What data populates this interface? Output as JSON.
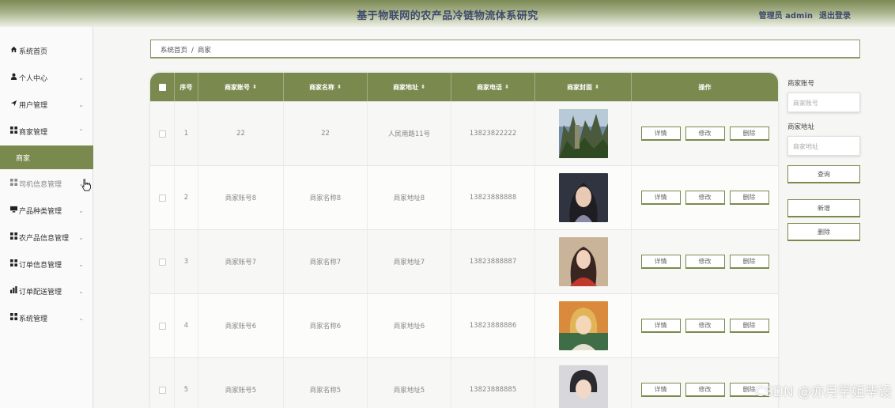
{
  "header": {
    "title": "基于物联网的农产品冷链物流体系研究",
    "user": "管理员 admin",
    "logout": "退出登录"
  },
  "sidebar": {
    "items": [
      {
        "label": "系统首页",
        "icon": "home-icon",
        "chevron": ""
      },
      {
        "label": "个人中心",
        "icon": "person-icon",
        "chevron": "chevron-down"
      },
      {
        "label": "用户管理",
        "icon": "send-icon",
        "chevron": "chevron-down"
      },
      {
        "label": "商家管理",
        "icon": "grid-icon",
        "chevron": "chevron-up"
      },
      {
        "label": "司机信息管理",
        "icon": "grid-icon",
        "chevron": "chevron-down"
      },
      {
        "label": "产品种类管理",
        "icon": "monitor-icon",
        "chevron": "chevron-down"
      },
      {
        "label": "农产品信息管理",
        "icon": "grid-icon",
        "chevron": "chevron-down"
      },
      {
        "label": "订单信息管理",
        "icon": "grid-icon",
        "chevron": "chevron-down"
      },
      {
        "label": "订单配送管理",
        "icon": "bar-chart-icon",
        "chevron": "chevron-down"
      },
      {
        "label": "系统管理",
        "icon": "grid-icon",
        "chevron": "chevron-down"
      }
    ],
    "active_sub": "商家"
  },
  "breadcrumb": {
    "home": "系统首页",
    "separator": "/",
    "current": "商家"
  },
  "table": {
    "headers": [
      "序号",
      "商家账号",
      "商家名称",
      "商家地址",
      "商家电话",
      "商家封面",
      "操作"
    ],
    "actions": {
      "detail": "详情",
      "edit": "修改",
      "delete": "删除"
    },
    "rows": [
      {
        "index": "1",
        "account": "22",
        "name": "22",
        "address": "人民南路11号",
        "phone": "13823822222"
      },
      {
        "index": "2",
        "account": "商家账号8",
        "name": "商家名称8",
        "address": "商家地址8",
        "phone": "13823888888"
      },
      {
        "index": "3",
        "account": "商家账号7",
        "name": "商家名称7",
        "address": "商家地址7",
        "phone": "13823888887"
      },
      {
        "index": "4",
        "account": "商家账号6",
        "name": "商家名称6",
        "address": "商家地址6",
        "phone": "13823888886"
      },
      {
        "index": "5",
        "account": "商家账号5",
        "name": "商家名称5",
        "address": "商家地址5",
        "phone": "13823888885"
      }
    ]
  },
  "search": {
    "account_label": "商家账号",
    "account_placeholder": "商家账号",
    "address_label": "商家地址",
    "address_placeholder": "商家地址",
    "query": "查询",
    "add": "新增",
    "delete": "删除"
  },
  "watermark": "CSDN @亦月学姐毕设",
  "colors": {
    "accent": "#7a8a4e",
    "header_text": "#3d4a6b"
  }
}
